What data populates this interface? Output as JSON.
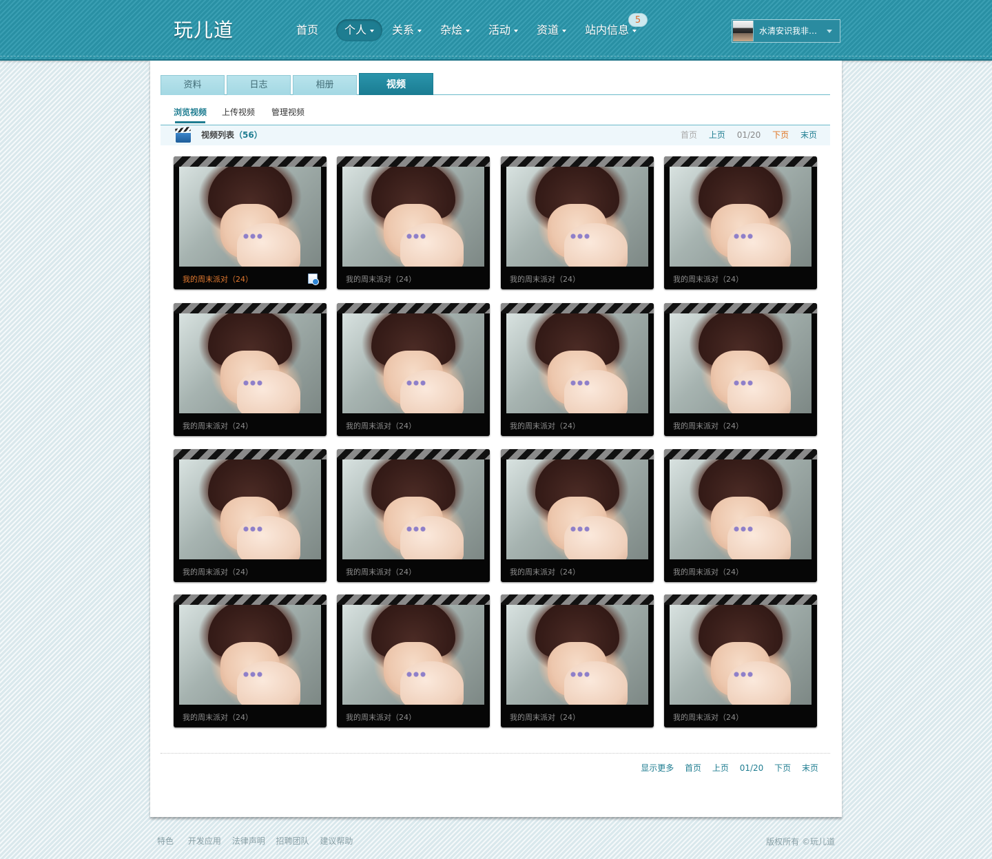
{
  "header": {
    "logo": "玩儿道",
    "nav": [
      {
        "label": "首页",
        "has_caret": false,
        "active": false
      },
      {
        "label": "个人",
        "has_caret": true,
        "active": true
      },
      {
        "label": "关系",
        "has_caret": true,
        "active": false
      },
      {
        "label": "杂烩",
        "has_caret": true,
        "active": false
      },
      {
        "label": "活动",
        "has_caret": true,
        "active": false
      },
      {
        "label": "资道",
        "has_caret": true,
        "active": false
      },
      {
        "label": "站内信息",
        "has_caret": true,
        "active": false
      }
    ],
    "message_count": "5",
    "user": {
      "name": "水清安识我非…",
      "avatar_icon": "user-avatar"
    }
  },
  "tabs": [
    {
      "label": "资料",
      "active": false
    },
    {
      "label": "日志",
      "active": false
    },
    {
      "label": "相册",
      "active": false
    },
    {
      "label": "视频",
      "active": true
    }
  ],
  "subtabs": [
    {
      "label": "浏览视频",
      "active": true
    },
    {
      "label": "上传视频",
      "active": false
    },
    {
      "label": "管理视频",
      "active": false
    }
  ],
  "list": {
    "icon": "clapperboard-icon",
    "title": "视频列表",
    "count": "（56）"
  },
  "pager_top": {
    "first": "首页",
    "prev": "上页",
    "page": "01/20",
    "next": "下页",
    "last": "末页"
  },
  "videos": [
    {
      "title": "我的周末派对（24）",
      "highlighted": true,
      "has_icon": true
    },
    {
      "title": "我的周末派对（24）",
      "highlighted": false,
      "has_icon": false
    },
    {
      "title": "我的周末派对（24）",
      "highlighted": false,
      "has_icon": false
    },
    {
      "title": "我的周末派对（24）",
      "highlighted": false,
      "has_icon": false
    },
    {
      "title": "我的周末派对（24）",
      "highlighted": false,
      "has_icon": false
    },
    {
      "title": "我的周末派对（24）",
      "highlighted": false,
      "has_icon": false
    },
    {
      "title": "我的周末派对（24）",
      "highlighted": false,
      "has_icon": false
    },
    {
      "title": "我的周末派对（24）",
      "highlighted": false,
      "has_icon": false
    },
    {
      "title": "我的周末派对（24）",
      "highlighted": false,
      "has_icon": false
    },
    {
      "title": "我的周末派对（24）",
      "highlighted": false,
      "has_icon": false
    },
    {
      "title": "我的周末派对（24）",
      "highlighted": false,
      "has_icon": false
    },
    {
      "title": "我的周末派对（24）",
      "highlighted": false,
      "has_icon": false
    },
    {
      "title": "我的周末派对（24）",
      "highlighted": false,
      "has_icon": false
    },
    {
      "title": "我的周末派对（24）",
      "highlighted": false,
      "has_icon": false
    },
    {
      "title": "我的周末派对（24）",
      "highlighted": false,
      "has_icon": false
    },
    {
      "title": "我的周末派对（24）",
      "highlighted": false,
      "has_icon": false
    }
  ],
  "pager_bottom": {
    "more": "显示更多",
    "first": "首页",
    "prev": "上页",
    "page": "01/20",
    "next": "下页",
    "last": "末页"
  },
  "footer": {
    "links": [
      "特色",
      "开发应用",
      "法律声明",
      "招聘团队",
      "建议帮助"
    ],
    "copyright": "版权所有 ©玩儿道"
  },
  "colors": {
    "header_bg": "#2b98ad",
    "accent": "#1f7d91",
    "highlight": "#e0731f"
  }
}
